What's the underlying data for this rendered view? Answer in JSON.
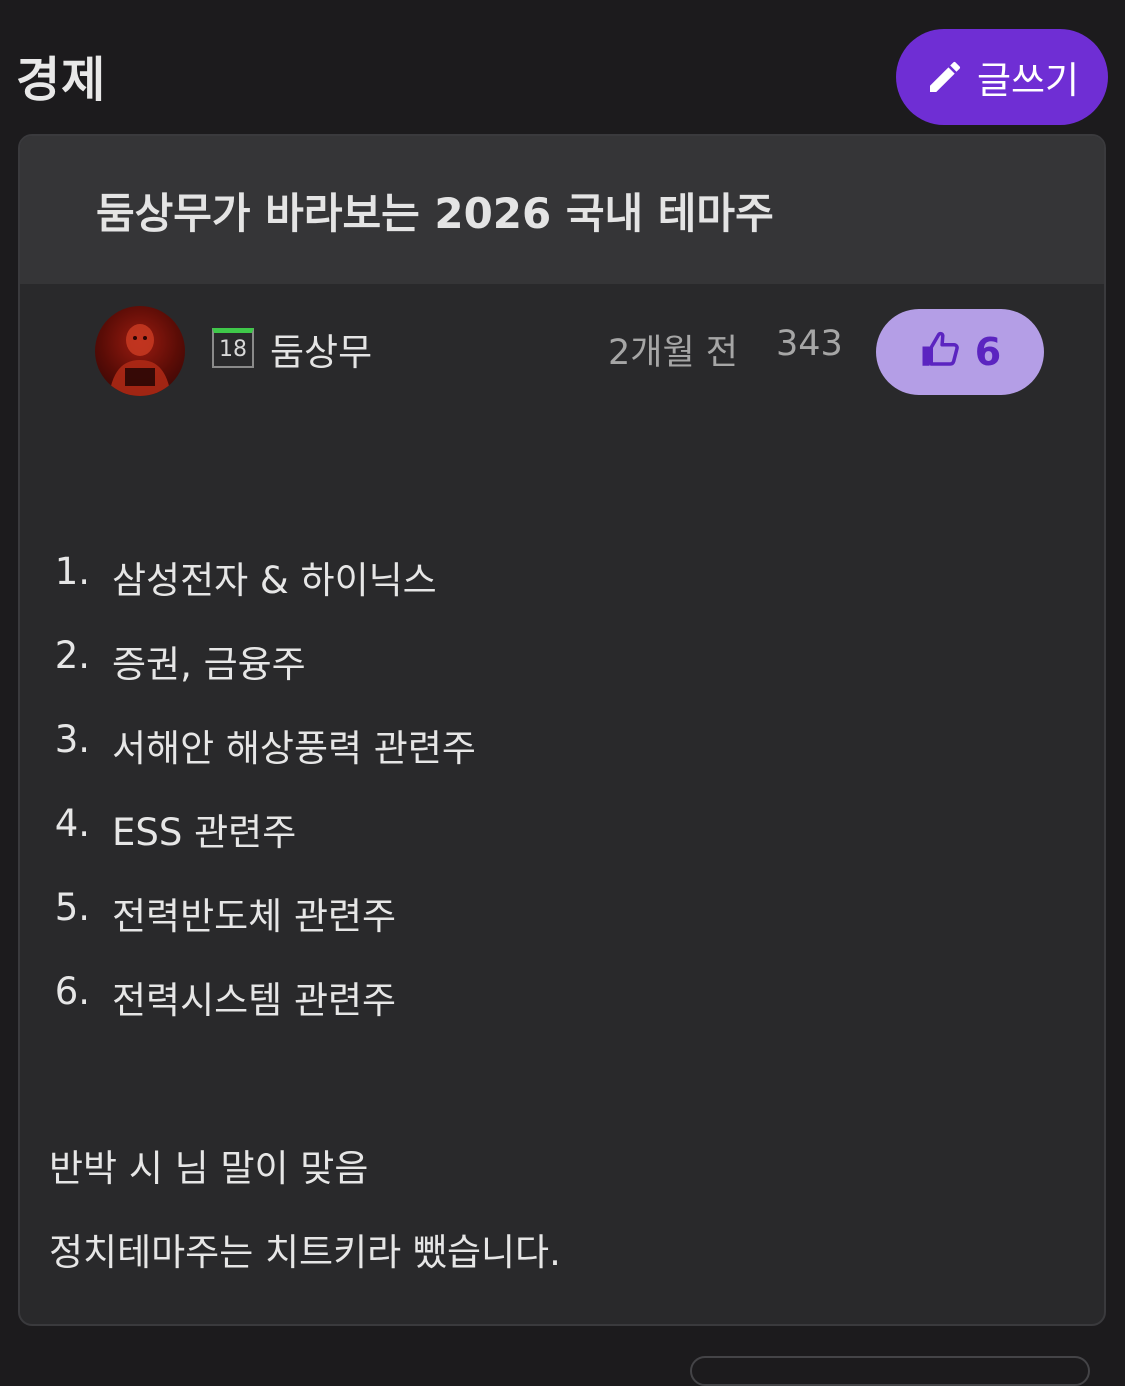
{
  "board": {
    "title": "경제",
    "write_button_label": "글쓰기",
    "write_icon": "pencil-icon"
  },
  "post": {
    "title": "둠상무가 바라보는 2026 국내 테마주",
    "author": {
      "name": "둠상무",
      "level": "18",
      "avatar_icon": "avatar-image"
    },
    "time": "2개월 전",
    "views": "343",
    "likes": {
      "icon": "thumbs-up-icon",
      "count": "6"
    },
    "list": [
      {
        "num": "1.",
        "text": "삼성전자 & 하이닉스"
      },
      {
        "num": "2.",
        "text": "증권, 금융주"
      },
      {
        "num": "3.",
        "text": "서해안 해상풍력 관련주"
      },
      {
        "num": "4.",
        "text": "ESS 관련주"
      },
      {
        "num": "5.",
        "text": "전력반도체 관련주"
      },
      {
        "num": "6.",
        "text": "전력시스템 관련주"
      }
    ],
    "paragraphs": [
      "반박 시 님 말이 맞음",
      "정치테마주는 치트키라 뺐습니다."
    ]
  },
  "colors": {
    "background": "#1c1b1d",
    "card": "#29292b",
    "header": "#353537",
    "accent": "#6f2ed4",
    "like_bg": "#b49ee6",
    "like_fg": "#5b24c0",
    "level_bar": "#3fc84a"
  }
}
